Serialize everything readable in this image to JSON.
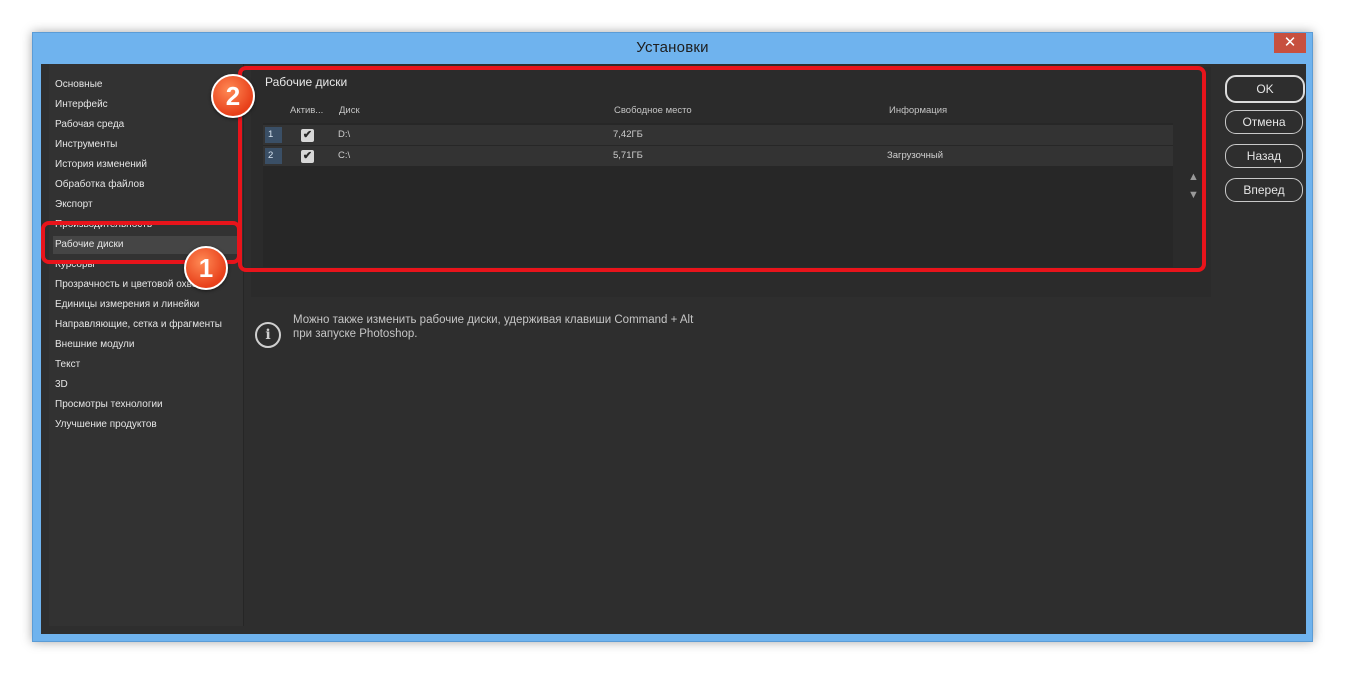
{
  "window": {
    "title": "Установки",
    "close": "✕"
  },
  "sidebar": {
    "items": [
      "Основные",
      "Интерфейс",
      "Рабочая среда",
      "Инструменты",
      "История изменений",
      "Обработка файлов",
      "Экспорт",
      "Производительность",
      "Рабочие диски",
      "Курсоры",
      "Прозрачность и цветовой охват",
      "Единицы измерения и линейки",
      "Направляющие, сетка и фрагменты",
      "Внешние модули",
      "Текст",
      "3D",
      "Просмотры технологии",
      "Улучшение продуктов"
    ],
    "selected": "Рабочие диски"
  },
  "scratch": {
    "title": "Рабочие диски",
    "columns": {
      "active": "Актив...",
      "disk": "Диск",
      "free": "Свободное место",
      "info": "Информация"
    },
    "rows": [
      {
        "num": "1",
        "active": true,
        "disk": "D:\\",
        "free": "7,42ГБ",
        "info": ""
      },
      {
        "num": "2",
        "active": true,
        "disk": "C:\\",
        "free": "5,71ГБ",
        "info": "Загрузочный"
      }
    ],
    "check_glyph": "✔",
    "up_arrow": "▲",
    "down_arrow": "▼"
  },
  "info": {
    "line1": "Можно также изменить рабочие диски, удерживая клавиши Command + Alt",
    "line2": "при запуске Photoshop.",
    "icon": "i"
  },
  "buttons": {
    "ok": "OK",
    "cancel": "Отмена",
    "back": "Назад",
    "forward": "Вперед"
  },
  "badges": {
    "one": "1",
    "two": "2"
  },
  "colors": {
    "callout": "#e8141b",
    "titlebar": "#6fb3ee"
  }
}
